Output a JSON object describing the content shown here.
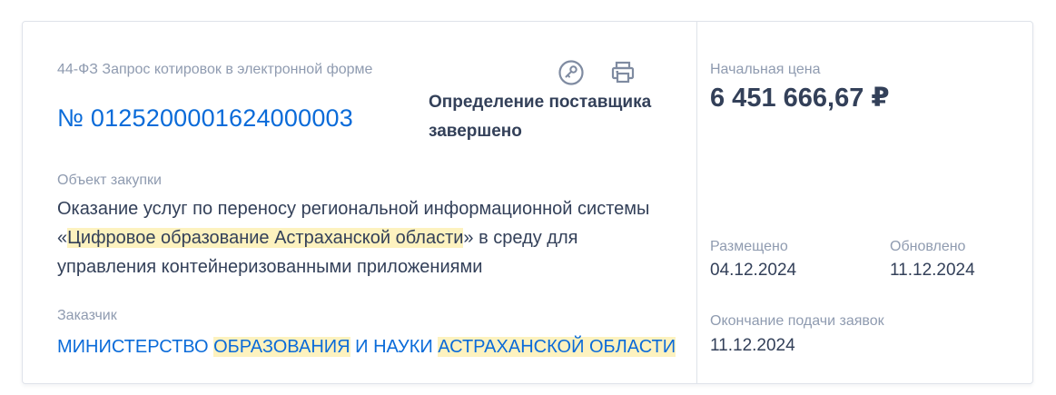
{
  "purchase": {
    "type": "44-ФЗ Запрос котировок в электронной форме",
    "number": "№ 0125200001624000003",
    "status": "Определение поставщика завершено"
  },
  "object": {
    "label": "Объект закупки",
    "text_before": "Оказание услуг по переносу региональной информационной системы «",
    "text_highlight": "Цифровое образование Астраханской области",
    "text_after": "» в среду для управления контейнеризованными приложениями"
  },
  "customer": {
    "label": "Заказчик",
    "part1": "МИНИСТЕРСТВО ",
    "part2": "ОБРАЗОВАНИЯ",
    "part3": " И НАУКИ ",
    "part4": "АСТРАХАНСКОЙ ОБЛАСТИ"
  },
  "price": {
    "label": "Начальная цена",
    "value": "6 451 666,67 ₽"
  },
  "dates": {
    "posted_label": "Размещено",
    "posted_value": "04.12.2024",
    "updated_label": "Обновлено",
    "updated_value": "11.12.2024",
    "end_label": "Окончание подачи заявок",
    "end_value": "11.12.2024"
  },
  "icons": {
    "key": "key-icon",
    "print": "printer-icon"
  },
  "colors": {
    "link": "#0a6bd9",
    "text": "#334059",
    "muted": "#8f9bb0",
    "highlight": "#fdf2bf",
    "icon": "#7f8ba1",
    "border": "#dfe3ea"
  }
}
